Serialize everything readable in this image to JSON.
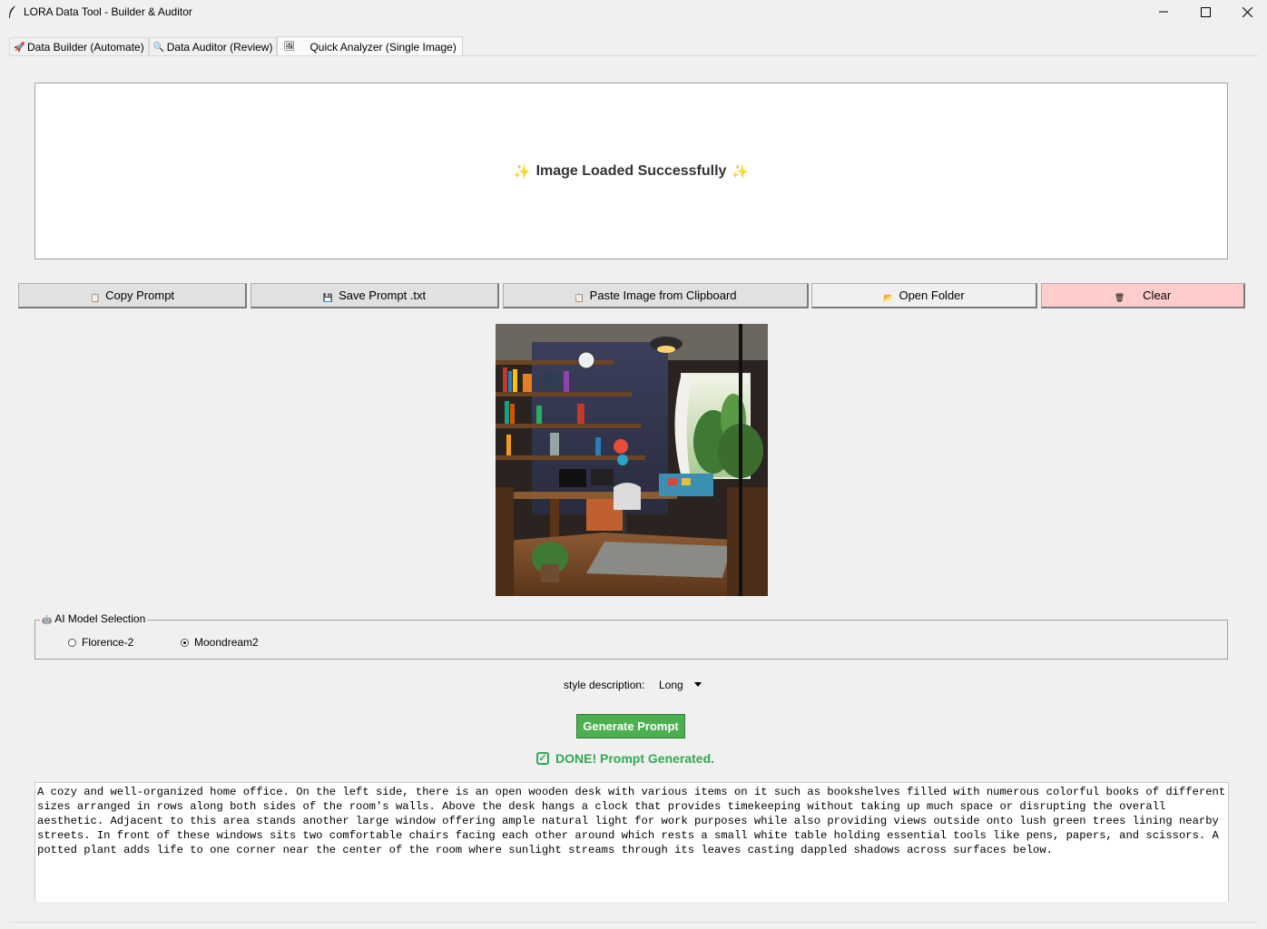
{
  "window": {
    "title": "LORA Data Tool - Builder & Auditor",
    "icon": "feather-icon"
  },
  "tabs": [
    {
      "label": "Data Builder (Automate)",
      "icon": "rocket-icon",
      "active": false
    },
    {
      "label": "Data Auditor (Review)",
      "icon": "magnifier-icon",
      "active": false
    },
    {
      "label": "Quick Analyzer (Single Image)",
      "icon": "image-icon",
      "active": true
    }
  ],
  "banner": {
    "message": "Image Loaded Successfully",
    "icon": "sparkles-icon"
  },
  "toolbar": {
    "copy_label": "Copy Prompt",
    "save_label": "Save Prompt .txt",
    "paste_label": "Paste Image from Clipboard",
    "open_label": "Open Folder",
    "clear_label": "Clear",
    "clear_color": "#ffcccc"
  },
  "model_selection": {
    "legend": "AI Model Selection",
    "options": [
      {
        "label": "Florence-2",
        "selected": false
      },
      {
        "label": "Moondream2",
        "selected": true
      }
    ]
  },
  "style": {
    "label": "style description:",
    "value": "Long"
  },
  "generate": {
    "label": "Generate Prompt",
    "color": "#4caf50"
  },
  "status": {
    "text": "DONE! Prompt Generated.",
    "color": "#34a853"
  },
  "output_text": "A cozy and well-organized home office. On the left side, there is an open wooden desk with various items on it such as bookshelves filled with numerous colorful books of different sizes arranged in rows along both sides of the room's walls. Above the desk hangs a clock that provides timekeeping without taking up much space or disrupting the overall aesthetic. Adjacent to this area stands another large window offering ample natural light for work purposes while also providing views outside onto lush green trees lining nearby streets. In front of these windows sits two comfortable chairs facing each other around which rests a small white table holding essential tools like pens, papers, and scissors. A potted plant adds life to one corner near the center of the room where sunlight streams through its leaves casting dappled shadows across surfaces below."
}
